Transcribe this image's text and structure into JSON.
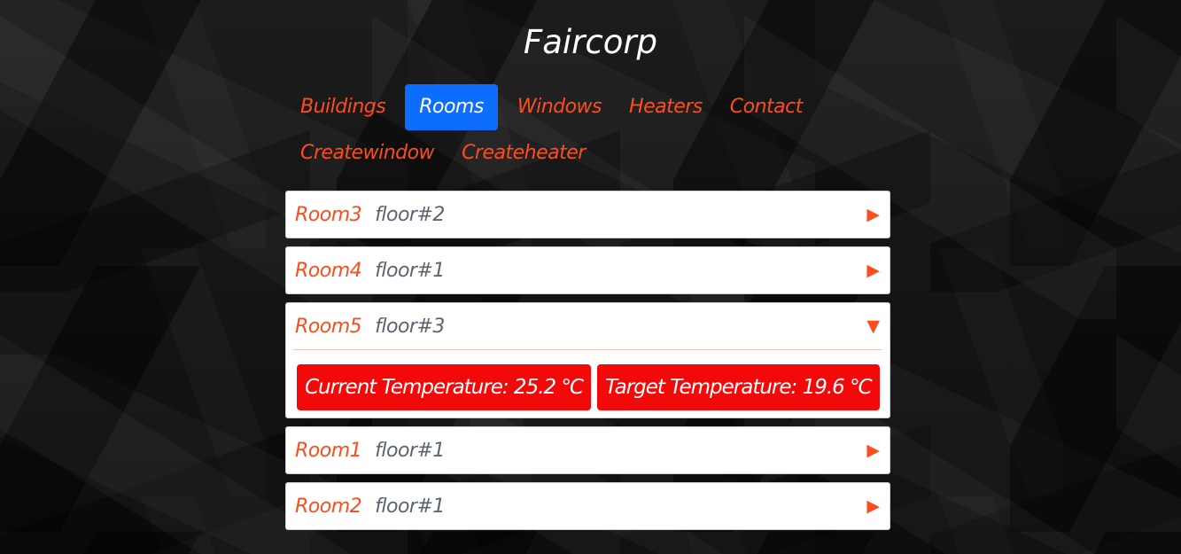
{
  "app": {
    "title": "Faircorp"
  },
  "nav": {
    "row1": [
      "Buildings",
      "Rooms",
      "Windows",
      "Heaters",
      "Contact"
    ],
    "row2": [
      "Createwindow",
      "Createheater"
    ],
    "active": "Rooms"
  },
  "rooms": [
    {
      "name": "Room3",
      "floor": "floor#2",
      "expanded": false,
      "toggle_icon": "▶"
    },
    {
      "name": "Room4",
      "floor": "floor#1",
      "expanded": false,
      "toggle_icon": "▶"
    },
    {
      "name": "Room5",
      "floor": "floor#3",
      "expanded": true,
      "toggle_icon": "▼",
      "current_temperature": "Current Temperature: 25.2 ℃",
      "target_temperature": "Target Temperature: 19.6 ℃"
    },
    {
      "name": "Room1",
      "floor": "floor#1",
      "expanded": false,
      "toggle_icon": "▶"
    },
    {
      "name": "Room2",
      "floor": "floor#1",
      "expanded": false,
      "toggle_icon": "▶"
    }
  ],
  "colors": {
    "accent": "#fd4d1c",
    "active_tab": "#0d6efd",
    "temperature_badge": "#f20a0a",
    "floor_text": "#5b6470"
  }
}
